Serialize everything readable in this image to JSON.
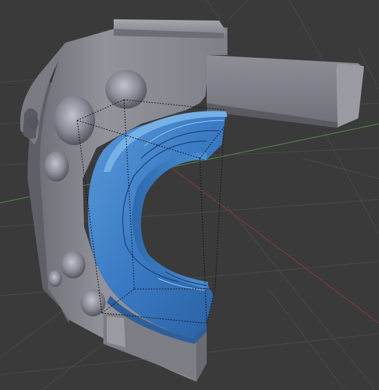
{
  "viewport": {
    "background": "#3a3a3a",
    "grid_color": "#4a4a4a",
    "x_axis_color": "#8a3a3a",
    "y_axis_color": "#4f8f3f"
  },
  "model": {
    "housing_color": "#8d8d96",
    "housing_shadow_color": "#6c6c74",
    "selected_part_color": "#3f7fc8",
    "selection_bbox_style": "dotted"
  }
}
